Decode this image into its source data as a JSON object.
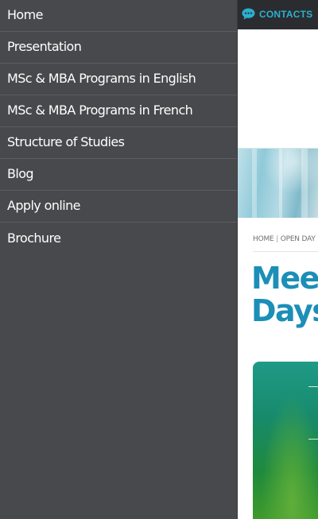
{
  "menu": {
    "items": [
      {
        "label": "Home"
      },
      {
        "label": "Presentation"
      },
      {
        "label": "MSc & MBA Programs in English"
      },
      {
        "label": "MSc & MBA Programs in French"
      },
      {
        "label": "Structure of Studies"
      },
      {
        "label": "Blog"
      },
      {
        "label": "Apply online"
      },
      {
        "label": "Brochure"
      }
    ]
  },
  "topbar": {
    "contacts_label": "CONTACTS",
    "contacts_icon": "chat-bubble-icon"
  },
  "breadcrumb": {
    "home": "HOME",
    "separator": "|",
    "current": "OPEN DAY"
  },
  "page": {
    "title_line1": "Meet",
    "title_line2": "Days"
  },
  "colors": {
    "menu_bg": "#48494c",
    "topbar_bg": "#2b2c2f",
    "accent": "#2ab0cf",
    "title": "#1b8fb7"
  }
}
